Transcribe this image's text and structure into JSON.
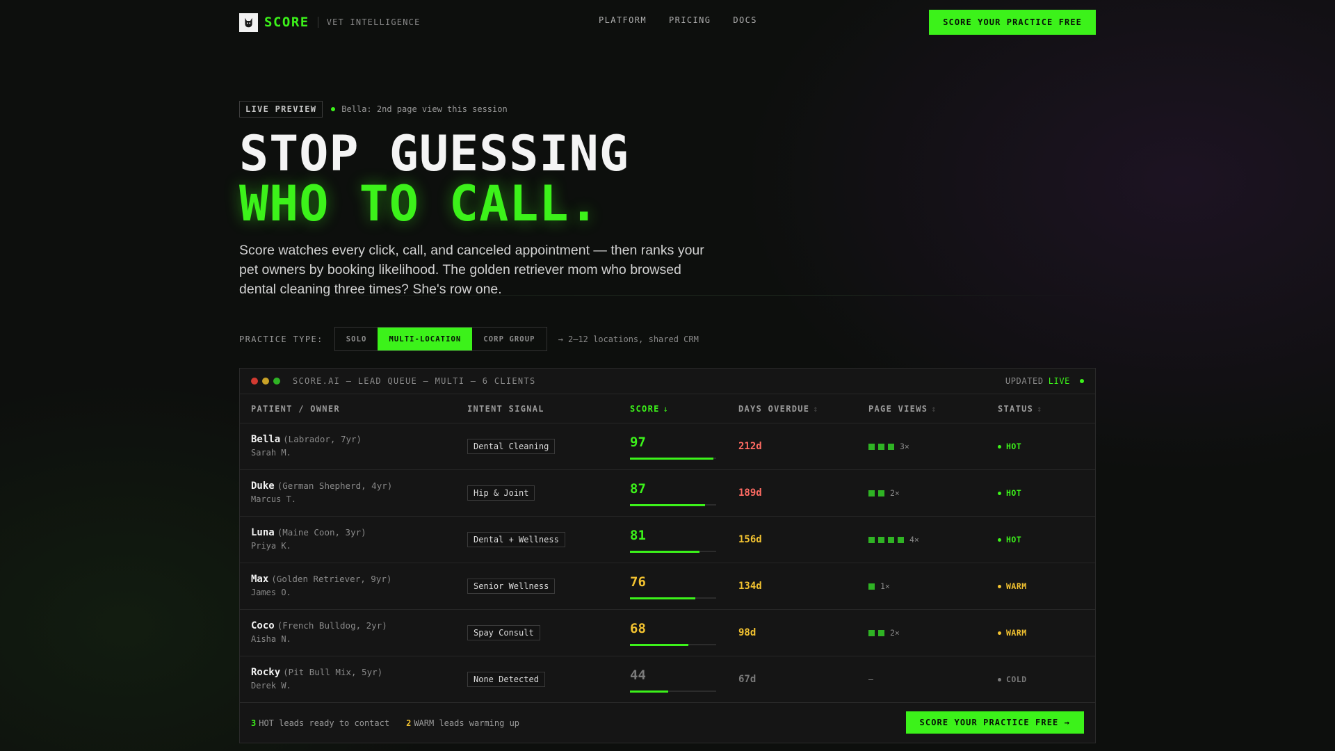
{
  "brand": {
    "name": "SCORE",
    "tagline": "VET INTELLIGENCE",
    "accent": "#3cf21a",
    "logo_icon": "cat-logo-icon"
  },
  "nav": {
    "links": [
      "PLATFORM",
      "PRICING",
      "DOCS"
    ],
    "cta": "SCORE YOUR PRACTICE FREE"
  },
  "hero": {
    "badge": "LIVE PREVIEW",
    "badge_note": "Bella: 2nd page view this session",
    "headline_1": "STOP GUESSING",
    "headline_2": "WHO TO CALL.",
    "lede": "Score watches every click, call, and canceled appointment — then ranks your pet owners by booking likelihood. The golden retriever mom who browsed dental cleaning three times? She's row one."
  },
  "practice_type": {
    "label": "PRACTICE TYPE:",
    "options": [
      "SOLO",
      "MULTI-LOCATION",
      "CORP GROUP"
    ],
    "selected": "MULTI-LOCATION",
    "note": "→ 2–12 locations, shared CRM"
  },
  "queue": {
    "title": "SCORE.AI — LEAD QUEUE — MULTI — 6 CLIENTS",
    "updated_label": "UPDATED",
    "updated_value": "LIVE",
    "columns": {
      "patient": "PATIENT / OWNER",
      "intent": "INTENT SIGNAL",
      "score": "SCORE",
      "score_sort": "↓",
      "overdue": "DAYS OVERDUE",
      "views": "PAGE VIEWS",
      "status": "STATUS",
      "sort_glyph": "↕"
    },
    "rows": [
      {
        "pet": "Bella",
        "breed": "(Labrador, 7yr)",
        "owner": "Sarah M.",
        "intent": "Dental Cleaning",
        "score": 97,
        "overdue": "212d",
        "views": 3,
        "views_label": "3×",
        "status": "HOT"
      },
      {
        "pet": "Duke",
        "breed": "(German Shepherd, 4yr)",
        "owner": "Marcus T.",
        "intent": "Hip & Joint",
        "score": 87,
        "overdue": "189d",
        "views": 2,
        "views_label": "2×",
        "status": "HOT"
      },
      {
        "pet": "Luna",
        "breed": "(Maine Coon, 3yr)",
        "owner": "Priya K.",
        "intent": "Dental + Wellness",
        "score": 81,
        "overdue": "156d",
        "views": 4,
        "views_label": "4×",
        "status": "HOT"
      },
      {
        "pet": "Max",
        "breed": "(Golden Retriever, 9yr)",
        "owner": "James O.",
        "intent": "Senior Wellness",
        "score": 76,
        "overdue": "134d",
        "views": 1,
        "views_label": "1×",
        "status": "WARM"
      },
      {
        "pet": "Coco",
        "breed": "(French Bulldog, 2yr)",
        "owner": "Aisha N.",
        "intent": "Spay Consult",
        "score": 68,
        "overdue": "98d",
        "views": 2,
        "views_label": "2×",
        "status": "WARM"
      },
      {
        "pet": "Rocky",
        "breed": "(Pit Bull Mix, 5yr)",
        "owner": "Derek W.",
        "intent": "None Detected",
        "score": 44,
        "overdue": "67d",
        "views": 0,
        "views_label": "—",
        "status": "COLD"
      }
    ],
    "footer": {
      "hot_count": "3",
      "hot_text": "HOT leads ready to contact",
      "warm_count": "2",
      "warm_text": "WARM leads warming up",
      "cta": "SCORE YOUR PRACTICE FREE →"
    }
  },
  "colors": {
    "hot": "#3cf21a",
    "warm": "#f2c230",
    "cold": "#7a7a7a",
    "overdue_high": "#ff6b63"
  }
}
